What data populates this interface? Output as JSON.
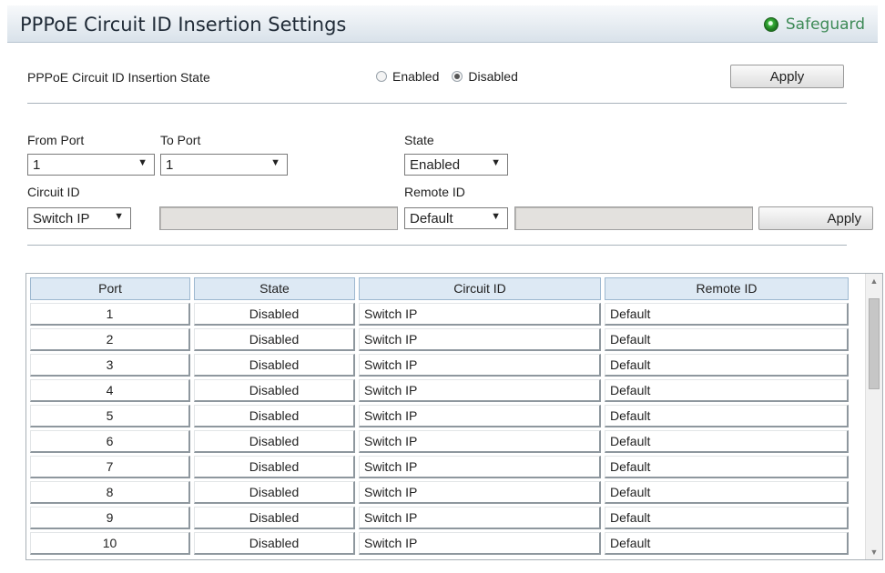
{
  "header": {
    "title": "PPPoE Circuit ID Insertion Settings",
    "safeguard": "Safeguard"
  },
  "global": {
    "state_label": "PPPoE Circuit ID Insertion State",
    "options": [
      "Enabled",
      "Disabled"
    ],
    "selected": "Disabled",
    "apply_label": "Apply"
  },
  "port_config": {
    "from_port_label": "From Port",
    "to_port_label": "To Port",
    "state_label": "State",
    "circuit_id_label": "Circuit ID",
    "remote_id_label": "Remote ID",
    "from_port_value": "1",
    "to_port_value": "1",
    "state_value": "Enabled",
    "circuit_id_value": "Switch IP",
    "remote_id_value": "Default",
    "circuit_id_text": "",
    "remote_id_text": "",
    "apply_label": "Apply"
  },
  "table": {
    "columns": [
      "Port",
      "State",
      "Circuit ID",
      "Remote ID"
    ],
    "rows": [
      [
        "1",
        "Disabled",
        "Switch IP",
        "Default"
      ],
      [
        "2",
        "Disabled",
        "Switch IP",
        "Default"
      ],
      [
        "3",
        "Disabled",
        "Switch IP",
        "Default"
      ],
      [
        "4",
        "Disabled",
        "Switch IP",
        "Default"
      ],
      [
        "5",
        "Disabled",
        "Switch IP",
        "Default"
      ],
      [
        "6",
        "Disabled",
        "Switch IP",
        "Default"
      ],
      [
        "7",
        "Disabled",
        "Switch IP",
        "Default"
      ],
      [
        "8",
        "Disabled",
        "Switch IP",
        "Default"
      ],
      [
        "9",
        "Disabled",
        "Switch IP",
        "Default"
      ],
      [
        "10",
        "Disabled",
        "Switch IP",
        "Default"
      ]
    ]
  }
}
